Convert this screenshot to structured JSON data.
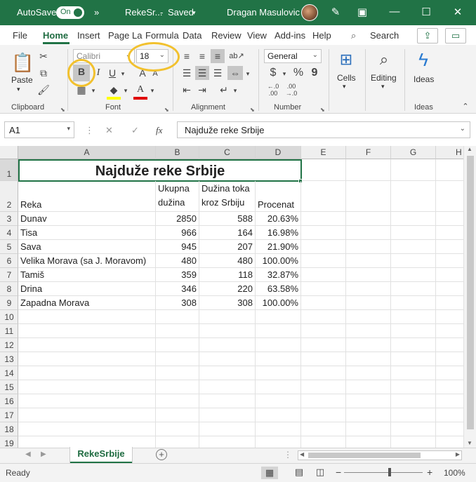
{
  "titlebar": {
    "autosave_label": "AutoSave",
    "autosave_state": "On",
    "more_glyph": "»",
    "filename": "RekeSr...",
    "dash": "-",
    "save_status": "Saved",
    "user_name": "Dragan Masulovic"
  },
  "tabs": [
    "File",
    "Home",
    "Insert",
    "Page La",
    "Formula",
    "Data",
    "Review",
    "View",
    "Add-ins",
    "Help"
  ],
  "search_label": "Search",
  "ribbon": {
    "clipboard": {
      "paste_label": "Paste",
      "group_label": "Clipboard"
    },
    "font": {
      "font_name": "Calibri",
      "font_size": "18",
      "bold": "B",
      "italic": "I",
      "underline": "U",
      "grow": "A",
      "shrink": "A",
      "group_label": "Font"
    },
    "alignment": {
      "group_label": "Alignment"
    },
    "number": {
      "format": "General",
      "currency": "$",
      "percent": "%",
      "comma": "9",
      "dec_inc": "←.0\n.00",
      "dec_dec": ".00\n→.0",
      "group_label": "Number"
    },
    "cells": {
      "label": "Cells"
    },
    "editing": {
      "label": "Editing"
    },
    "ideas": {
      "label": "Ideas",
      "group_label": "Ideas"
    }
  },
  "formula_bar": {
    "name_box": "A1",
    "cancel": "✕",
    "enter": "✓",
    "fx": "fx",
    "content": "Najduže reke Srbije"
  },
  "columns": [
    "A",
    "B",
    "C",
    "D",
    "E",
    "F",
    "G",
    "H"
  ],
  "rows": [
    "1",
    "2",
    "3",
    "4",
    "5",
    "6",
    "7",
    "8",
    "9",
    "10",
    "11",
    "12",
    "13",
    "14",
    "15",
    "16",
    "17",
    "18",
    "19"
  ],
  "sheet": {
    "title": "Najduže reke Srbije",
    "header": {
      "a": "Reka",
      "b": "Ukupna dužina",
      "c": "Dužina toka kroz Srbiju",
      "d": "Procenat"
    },
    "data": [
      [
        "Dunav",
        "2850",
        "588",
        "20.63%"
      ],
      [
        "Tisa",
        "966",
        "164",
        "16.98%"
      ],
      [
        "Sava",
        "945",
        "207",
        "21.90%"
      ],
      [
        "Velika Morava (sa J. Moravom)",
        "480",
        "480",
        "100.00%"
      ],
      [
        "Tamiš",
        "359",
        "118",
        "32.87%"
      ],
      [
        "Drina",
        "346",
        "220",
        "63.58%"
      ],
      [
        "Zapadna Morava",
        "308",
        "308",
        "100.00%"
      ]
    ]
  },
  "sheet_tab": "RekeSrbije",
  "status": {
    "ready": "Ready",
    "zoom_minus": "−",
    "zoom_plus": "+",
    "zoom": "100%"
  },
  "colors": {
    "accent": "#217346",
    "highlight_ring": "#f2c12e",
    "font_color": "#e00000",
    "fill_color": "#ffff00"
  }
}
